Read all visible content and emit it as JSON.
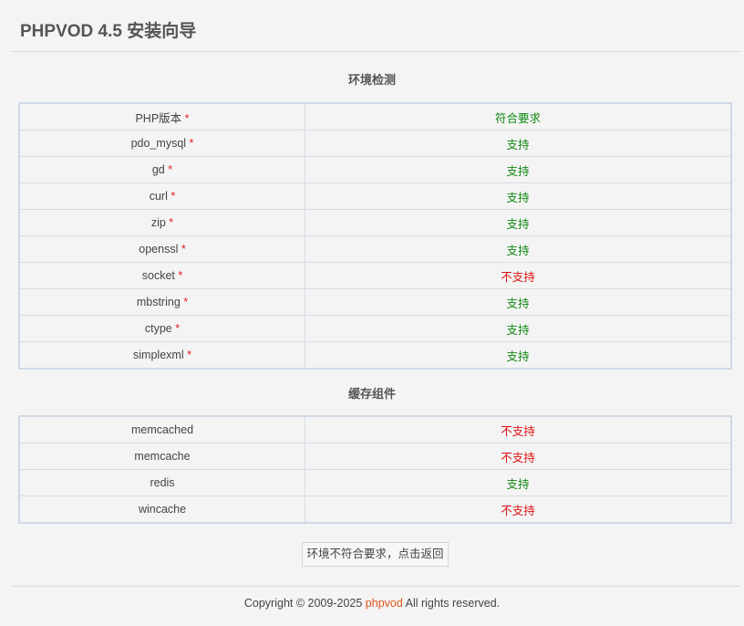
{
  "header": {
    "title": "PHPVOD 4.5 安装向导"
  },
  "env_check": {
    "title": "环境检测",
    "required_mark": "*",
    "rows": [
      {
        "name": "PHP版本",
        "status": "符合要求",
        "ok": true
      },
      {
        "name": "pdo_mysql",
        "status": "支持",
        "ok": true
      },
      {
        "name": "gd",
        "status": "支持",
        "ok": true
      },
      {
        "name": "curl",
        "status": "支持",
        "ok": true
      },
      {
        "name": "zip",
        "status": "支持",
        "ok": true
      },
      {
        "name": "openssl",
        "status": "支持",
        "ok": true
      },
      {
        "name": "socket",
        "status": "不支持",
        "ok": false
      },
      {
        "name": "mbstring",
        "status": "支持",
        "ok": true
      },
      {
        "name": "ctype",
        "status": "支持",
        "ok": true
      },
      {
        "name": "simplexml",
        "status": "支持",
        "ok": true
      }
    ]
  },
  "cache": {
    "title": "缓存组件",
    "rows": [
      {
        "name": "memcached",
        "status": "不支持",
        "ok": false
      },
      {
        "name": "memcache",
        "status": "不支持",
        "ok": false
      },
      {
        "name": "redis",
        "status": "支持",
        "ok": true
      },
      {
        "name": "wincache",
        "status": "不支持",
        "ok": false
      }
    ]
  },
  "actions": {
    "back_label": "环境不符合要求，点击返回"
  },
  "footer": {
    "prefix": "Copyright © 2009-2025",
    "brand": "phpvod",
    "suffix": "All rights reserved."
  },
  "colors": {
    "ok": "#118811",
    "bad": "#dd1111",
    "required": "#e02020",
    "brand": "#e0551a"
  }
}
